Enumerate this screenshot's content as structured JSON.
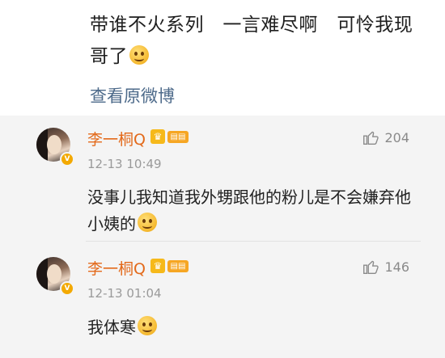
{
  "post": {
    "text": "带谁不火系列   一言难尽啊   可怜我现哥了",
    "emoji": "laughing-emoji",
    "view_original": "查看原微博"
  },
  "comments": [
    {
      "name": "李一桐Q",
      "time": "12-13 10:49",
      "likes": "204",
      "text": "没事儿我知道我外甥跟他的粉儿是不会嫌弃他小姨的",
      "emoji": "thinking-emoji"
    },
    {
      "name": "李一桐Q",
      "time": "12-13 01:04",
      "likes": "146",
      "text": "我体寒",
      "emoji": "shy-emoji"
    }
  ],
  "colors": {
    "name": "#e36a1b",
    "link": "#4d6a8a",
    "comment_bg": "#f4f4f4"
  }
}
